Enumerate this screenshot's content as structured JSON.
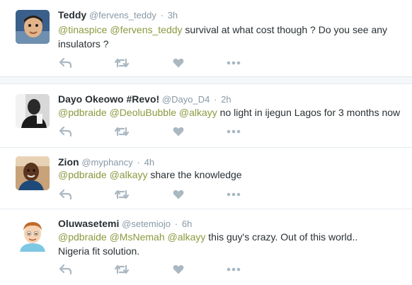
{
  "colors": {
    "mention": "#8a9a3f",
    "action_icon": "#aab8c2",
    "thread_line": "#9ab06a"
  },
  "tweets": [
    {
      "name": "Teddy",
      "handle": "@fervens_teddy",
      "dot": "·",
      "time": "3h",
      "avatar_icon": "child-photo",
      "mentions": [
        "@tinaspice",
        "@fervens_teddy"
      ],
      "text_line1": " survival at what cost though ? Do you see any",
      "text_line2": "insulators ?"
    },
    {
      "name": "Dayo Okeowo #Revo!",
      "handle": "@Dayo_D4",
      "dot": "·",
      "time": "2h",
      "avatar_icon": "bw-portrait-photo",
      "mentions": [
        "@pdbraide",
        "@DeoluBubble",
        "@alkayy"
      ],
      "text_line1": " no light in ijegun Lagos for 3 months now"
    },
    {
      "name": "Zion",
      "handle": "@myphancy",
      "dot": "·",
      "time": "4h",
      "avatar_icon": "man-photo",
      "mentions": [
        "@pdbraide",
        "@alkayy"
      ],
      "text_line1": " share the knowledge"
    },
    {
      "name": "Oluwasetemi",
      "handle": "@setemiojo",
      "dot": "·",
      "time": "6h",
      "avatar_icon": "cartoon-avatar",
      "mentions": [
        "@pdbraide",
        "@MsNemah",
        "@alkayy"
      ],
      "text_line1": " this guy's crazy. Out of this world..",
      "text_line2": "Nigeria fit solution."
    }
  ],
  "actions": [
    {
      "name": "reply",
      "icon": "reply-icon"
    },
    {
      "name": "retweet",
      "icon": "retweet-icon"
    },
    {
      "name": "like",
      "icon": "heart-icon"
    },
    {
      "name": "more",
      "icon": "more-icon"
    }
  ]
}
